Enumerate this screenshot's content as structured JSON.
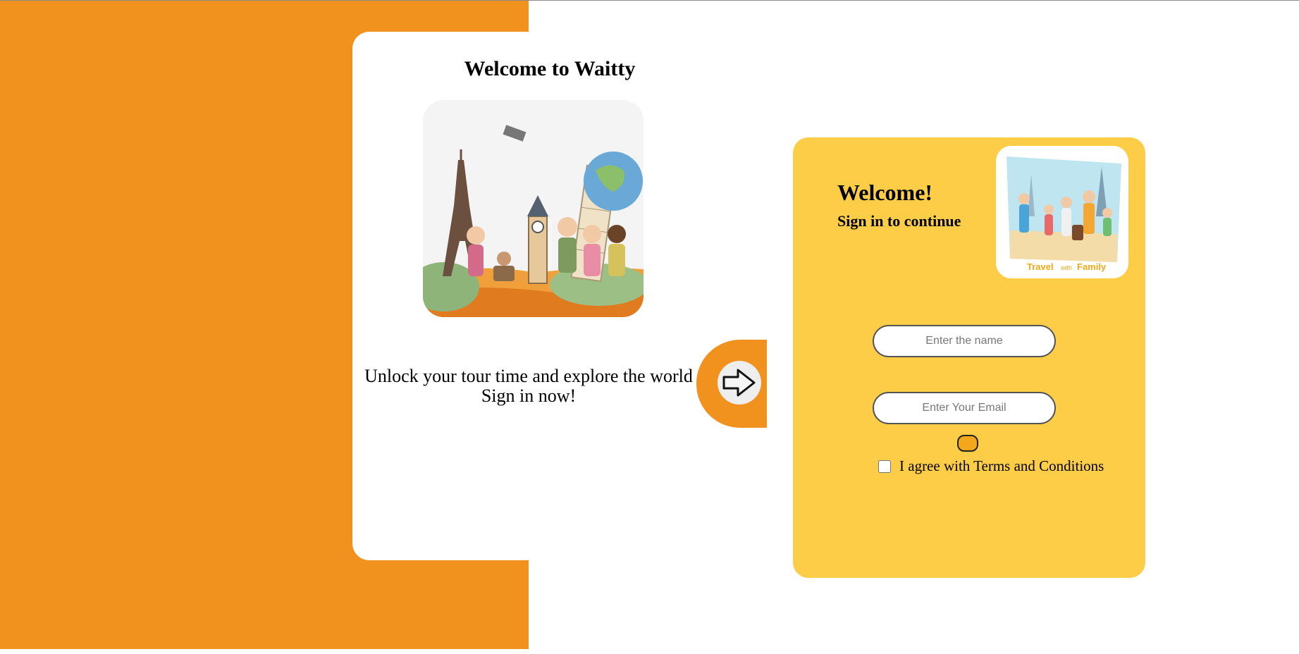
{
  "left_panel": {
    "title": "Welcome to Waitty",
    "tagline_line1": "Unlock your tour time and explore the world",
    "tagline_line2": "Sign in now!",
    "illustration_icon": "travel-landmarks-illustration"
  },
  "arrow": {
    "icon": "arrow-right-icon"
  },
  "right_panel": {
    "heading": "Welcome!",
    "subheading": "Sign in to continue",
    "image_caption_1": "Travel",
    "image_caption_2": "with",
    "image_caption_3": "Family"
  },
  "form": {
    "name_placeholder": "Enter the name",
    "email_placeholder": "Enter Your Email",
    "terms_label": "I agree with Terms and Conditions",
    "terms_checked": false
  },
  "colors": {
    "orange": "#f2921e",
    "yellow": "#fdcd48",
    "button": "#f2a81a"
  }
}
